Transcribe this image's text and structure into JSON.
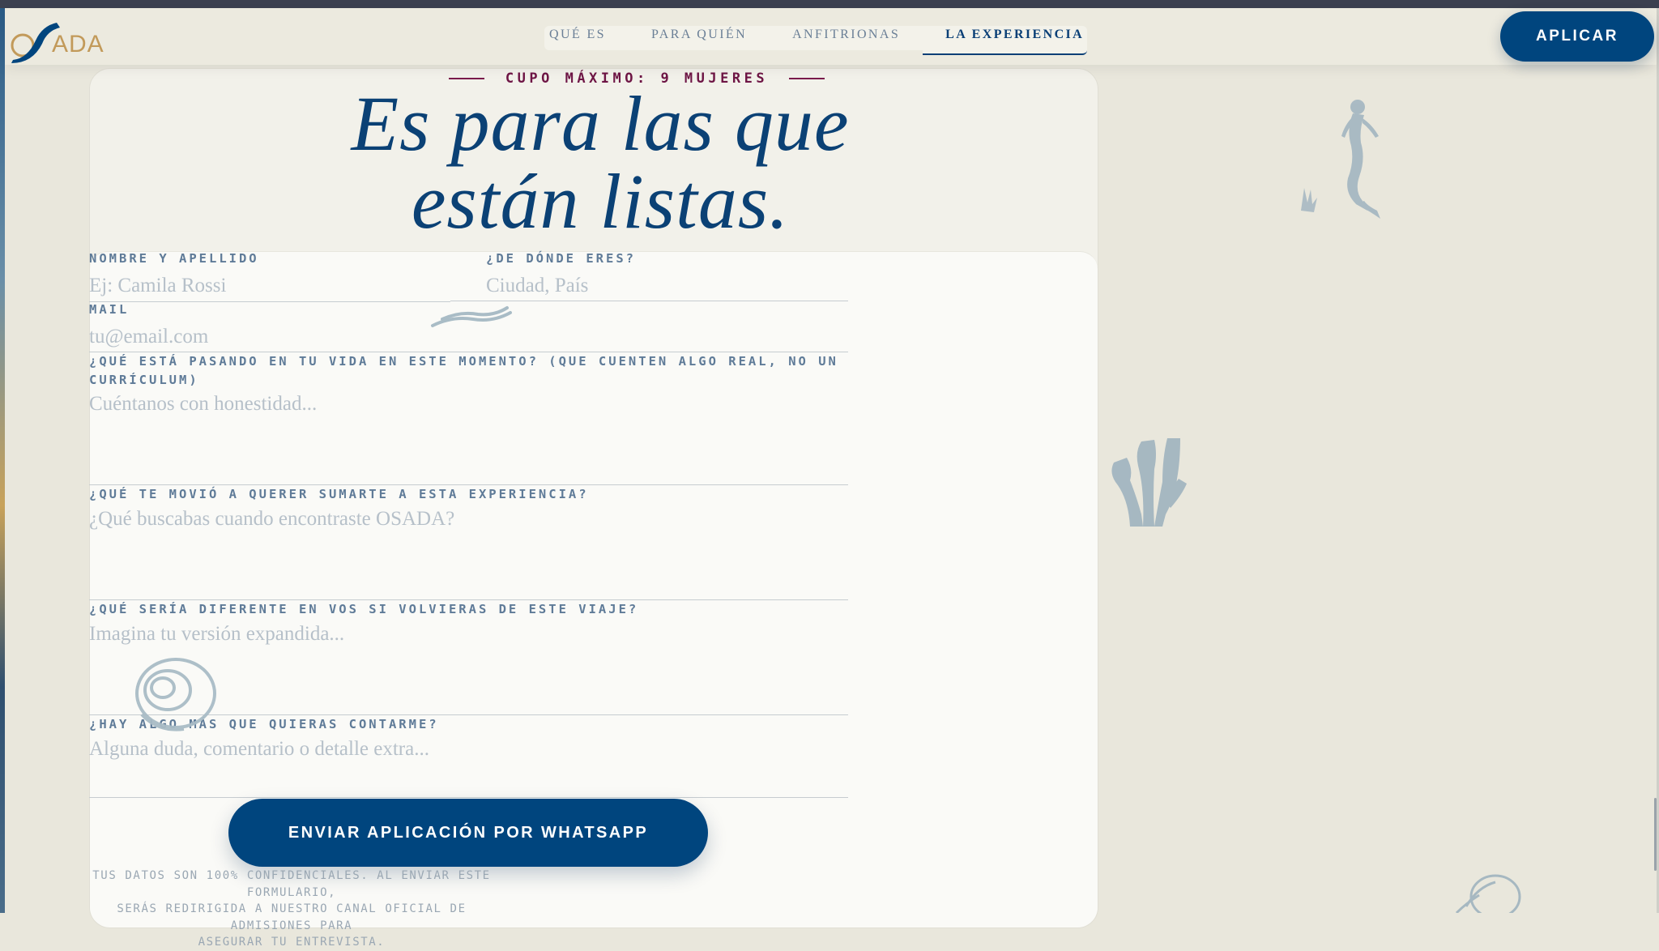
{
  "brand": {
    "logo_text": "OSADA",
    "accent": "#00457e",
    "logo_gold": "#c29a5a"
  },
  "nav": {
    "items": [
      {
        "label": "QUÉ ES"
      },
      {
        "label": "PARA QUIÉN"
      },
      {
        "label": "ANFITRIONAS"
      },
      {
        "label": "LA EXPERIENCIA"
      }
    ],
    "active": "LA EXPERIENCIA"
  },
  "header": {
    "apply_label": "APLICAR"
  },
  "hero": {
    "kicker": "CUPO MÁXIMO: 9 MUJERES",
    "headline_line1": "Es para las que",
    "headline_line2": "están listas."
  },
  "form": {
    "name": {
      "label": "NOMBRE Y APELLIDO",
      "placeholder": "Ej: Camila Rossi"
    },
    "origin": {
      "label": "¿DE DÓNDE ERES?",
      "placeholder": "Ciudad, País"
    },
    "mail": {
      "label": "MAIL",
      "placeholder": "tu@email.com"
    },
    "q1": {
      "label_line1": "¿QUÉ ESTÁ PASANDO EN TU VIDA EN ESTE MOMENTO? (QUE CUENTEN ALGO REAL, NO UN",
      "label_line2": "CURRÍCULUM)",
      "placeholder": "Cuéntanos con honestidad..."
    },
    "q2": {
      "label": "¿QUÉ TE MOVIÓ A QUERER SUMARTE A ESTA EXPERIENCIA?",
      "placeholder": "¿Qué buscabas cuando encontraste OSADA?"
    },
    "q3": {
      "label": "¿QUÉ SERÍA DIFERENTE EN VOS SI VOLVIERAS DE ESTE VIAJE?",
      "placeholder": "Imagina tu versión expandida..."
    },
    "q4": {
      "label": "¿HAY ALGO MÁS QUE QUIERAS CONTARME?",
      "placeholder": "Alguna duda, comentario o detalle extra..."
    },
    "submit_label": "ENVIAR APLICACIÓN POR WHATSAPP",
    "disclaimer_line1": "TUS DATOS SON 100% CONFIDENCIALES. AL ENVIAR ESTE FORMULARIO,",
    "disclaimer_line2": "SERÁS REDIRIGIDA A NUESTRO CANAL OFICIAL DE ADMISIONES PARA",
    "disclaimer_line3": "ASEGURAR TU ENTREVISTA."
  }
}
